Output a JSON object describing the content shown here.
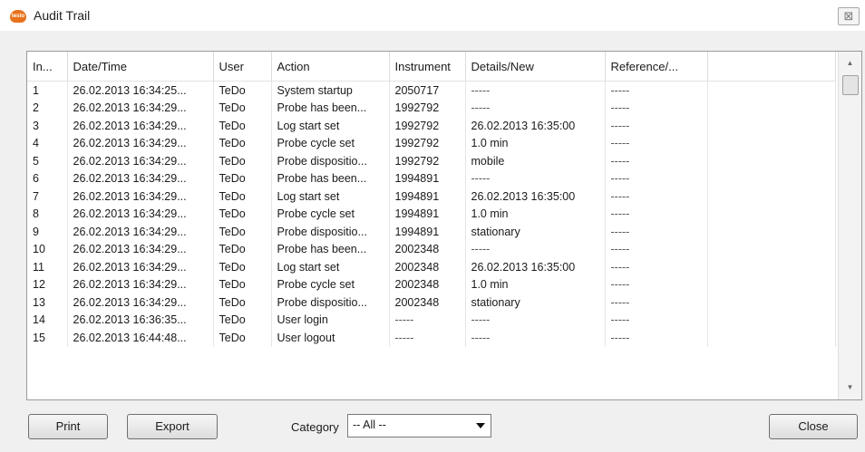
{
  "window": {
    "title": "Audit Trail",
    "app_icon_label": "testo",
    "close_glyph": "⊠"
  },
  "table": {
    "columns": [
      "In...",
      "Date/Time",
      "User",
      "Action",
      "Instrument",
      "Details/New",
      "Reference/...",
      ""
    ],
    "rows": [
      [
        "1",
        "26.02.2013 16:34:25...",
        "TeDo",
        "System startup",
        "2050717",
        "-----",
        "-----"
      ],
      [
        "2",
        "26.02.2013 16:34:29...",
        "TeDo",
        "Probe has been...",
        "1992792",
        "-----",
        "-----"
      ],
      [
        "3",
        "26.02.2013 16:34:29...",
        "TeDo",
        "Log start set",
        "1992792",
        "26.02.2013 16:35:00",
        "-----"
      ],
      [
        "4",
        "26.02.2013 16:34:29...",
        "TeDo",
        "Probe cycle set",
        "1992792",
        "1.0 min",
        "-----"
      ],
      [
        "5",
        "26.02.2013 16:34:29...",
        "TeDo",
        "Probe dispositio...",
        "1992792",
        "mobile",
        "-----"
      ],
      [
        "6",
        "26.02.2013 16:34:29...",
        "TeDo",
        "Probe has been...",
        "1994891",
        "-----",
        "-----"
      ],
      [
        "7",
        "26.02.2013 16:34:29...",
        "TeDo",
        "Log start set",
        "1994891",
        "26.02.2013 16:35:00",
        "-----"
      ],
      [
        "8",
        "26.02.2013 16:34:29...",
        "TeDo",
        "Probe cycle set",
        "1994891",
        "1.0 min",
        "-----"
      ],
      [
        "9",
        "26.02.2013 16:34:29...",
        "TeDo",
        "Probe dispositio...",
        "1994891",
        "stationary",
        "-----"
      ],
      [
        "10",
        "26.02.2013 16:34:29...",
        "TeDo",
        "Probe has been...",
        "2002348",
        "-----",
        "-----"
      ],
      [
        "11",
        "26.02.2013 16:34:29...",
        "TeDo",
        "Log start set",
        "2002348",
        "26.02.2013 16:35:00",
        "-----"
      ],
      [
        "12",
        "26.02.2013 16:34:29...",
        "TeDo",
        "Probe cycle set",
        "2002348",
        "1.0 min",
        "-----"
      ],
      [
        "13",
        "26.02.2013 16:34:29...",
        "TeDo",
        "Probe dispositio...",
        "2002348",
        "stationary",
        "-----"
      ],
      [
        "14",
        "26.02.2013 16:36:35...",
        "TeDo",
        "User login",
        "-----",
        "-----",
        "-----"
      ],
      [
        "15",
        "26.02.2013 16:44:48...",
        "TeDo",
        "User logout",
        "-----",
        "-----",
        "-----"
      ]
    ]
  },
  "scrollbar": {
    "up_glyph": "▲",
    "down_glyph": "▼"
  },
  "footer": {
    "print_label": "Print",
    "export_label": "Export",
    "category_label": "Category",
    "category_value": "-- All --",
    "close_label": "Close"
  }
}
